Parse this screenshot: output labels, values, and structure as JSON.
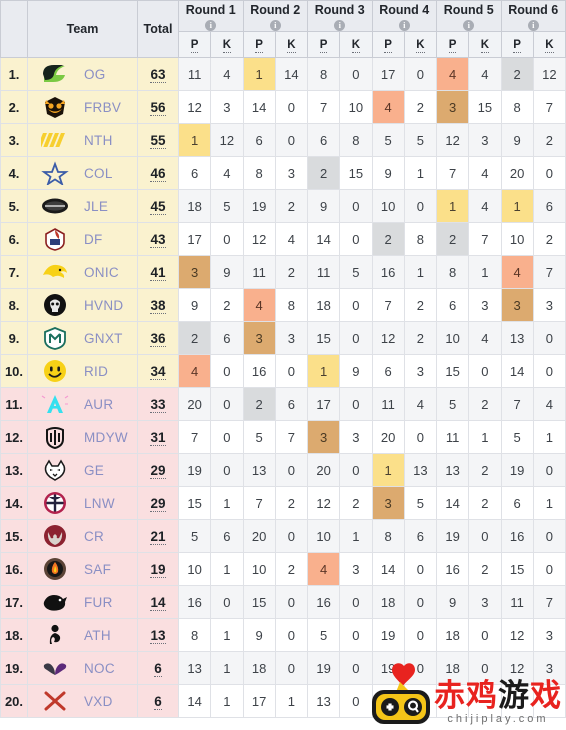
{
  "header": {
    "rank_label": "",
    "team_label": "Team",
    "total_label": "Total",
    "rounds": [
      {
        "label": "Round 1",
        "info": "i",
        "p": "P",
        "k": "K"
      },
      {
        "label": "Round 2",
        "info": "i",
        "p": "P",
        "k": "K"
      },
      {
        "label": "Round 3",
        "info": "i",
        "p": "P",
        "k": "K"
      },
      {
        "label": "Round 4",
        "info": "i",
        "p": "P",
        "k": "K"
      },
      {
        "label": "Round 5",
        "info": "i",
        "p": "P",
        "k": "K"
      },
      {
        "label": "Round 6",
        "info": "i",
        "p": "P",
        "k": "K"
      }
    ]
  },
  "colors": {
    "place_1": "#fbe08a",
    "place_2": "#d9dbdd",
    "place_3": "#dcaa6f",
    "place_4": "#f9b08d",
    "band_gold": "#faf2cf",
    "band_pink": "#fadfe0",
    "team_text": "#8a8fc4",
    "header_bg": "#e9ebf0"
  },
  "watermark": {
    "cn_red_1": "赤鸡",
    "cn_black": "游",
    "cn_red_2": "戏",
    "url": "chijiplay.com",
    "logo": "gamepad-heart-logo"
  },
  "rows": [
    {
      "rank": "1.",
      "team": "OG",
      "logo": "og-logo",
      "total": "63",
      "band": "gold",
      "cells": [
        {
          "v": "11"
        },
        {
          "v": "4"
        },
        {
          "v": "1",
          "hl": 1
        },
        {
          "v": "14"
        },
        {
          "v": "8"
        },
        {
          "v": "0"
        },
        {
          "v": "17"
        },
        {
          "v": "0"
        },
        {
          "v": "4",
          "hl": 4
        },
        {
          "v": "4"
        },
        {
          "v": "2",
          "hl": 2
        },
        {
          "v": "12"
        }
      ]
    },
    {
      "rank": "2.",
      "team": "FRBV",
      "logo": "frbv-logo",
      "total": "56",
      "band": "gold",
      "cells": [
        {
          "v": "12"
        },
        {
          "v": "3"
        },
        {
          "v": "14"
        },
        {
          "v": "0"
        },
        {
          "v": "7"
        },
        {
          "v": "10"
        },
        {
          "v": "4",
          "hl": 4
        },
        {
          "v": "2"
        },
        {
          "v": "3",
          "hl": 3
        },
        {
          "v": "15"
        },
        {
          "v": "8"
        },
        {
          "v": "7"
        }
      ]
    },
    {
      "rank": "3.",
      "team": "NTH",
      "logo": "nth-logo",
      "total": "55",
      "band": "gold",
      "cells": [
        {
          "v": "1",
          "hl": 1
        },
        {
          "v": "12"
        },
        {
          "v": "6"
        },
        {
          "v": "0"
        },
        {
          "v": "6"
        },
        {
          "v": "8"
        },
        {
          "v": "5"
        },
        {
          "v": "5"
        },
        {
          "v": "12"
        },
        {
          "v": "3"
        },
        {
          "v": "9"
        },
        {
          "v": "2"
        }
      ]
    },
    {
      "rank": "4.",
      "team": "COL",
      "logo": "col-logo",
      "total": "46",
      "band": "gold",
      "cells": [
        {
          "v": "6"
        },
        {
          "v": "4"
        },
        {
          "v": "8"
        },
        {
          "v": "3"
        },
        {
          "v": "2",
          "hl": 2
        },
        {
          "v": "15"
        },
        {
          "v": "9"
        },
        {
          "v": "1"
        },
        {
          "v": "7"
        },
        {
          "v": "4"
        },
        {
          "v": "20"
        },
        {
          "v": "0"
        }
      ]
    },
    {
      "rank": "5.",
      "team": "JLE",
      "logo": "jle-logo",
      "total": "45",
      "band": "gold",
      "cells": [
        {
          "v": "18"
        },
        {
          "v": "5"
        },
        {
          "v": "19"
        },
        {
          "v": "2"
        },
        {
          "v": "9"
        },
        {
          "v": "0"
        },
        {
          "v": "10"
        },
        {
          "v": "0"
        },
        {
          "v": "1",
          "hl": 1
        },
        {
          "v": "4"
        },
        {
          "v": "1",
          "hl": 1
        },
        {
          "v": "6"
        }
      ]
    },
    {
      "rank": "6.",
      "team": "DF",
      "logo": "df-logo",
      "total": "43",
      "band": "gold",
      "cells": [
        {
          "v": "17"
        },
        {
          "v": "0"
        },
        {
          "v": "12"
        },
        {
          "v": "4"
        },
        {
          "v": "14"
        },
        {
          "v": "0"
        },
        {
          "v": "2",
          "hl": 2
        },
        {
          "v": "8"
        },
        {
          "v": "2",
          "hl": 2
        },
        {
          "v": "7"
        },
        {
          "v": "10"
        },
        {
          "v": "2"
        }
      ]
    },
    {
      "rank": "7.",
      "team": "ONIC",
      "logo": "onic-logo",
      "total": "41",
      "band": "gold",
      "cells": [
        {
          "v": "3",
          "hl": 3
        },
        {
          "v": "9"
        },
        {
          "v": "11"
        },
        {
          "v": "2"
        },
        {
          "v": "11"
        },
        {
          "v": "5"
        },
        {
          "v": "16"
        },
        {
          "v": "1"
        },
        {
          "v": "8"
        },
        {
          "v": "1"
        },
        {
          "v": "4",
          "hl": 4
        },
        {
          "v": "7"
        }
      ]
    },
    {
      "rank": "8.",
      "team": "HVND",
      "logo": "hvnd-logo",
      "total": "38",
      "band": "gold",
      "cells": [
        {
          "v": "9"
        },
        {
          "v": "2"
        },
        {
          "v": "4",
          "hl": 4
        },
        {
          "v": "8"
        },
        {
          "v": "18"
        },
        {
          "v": "0"
        },
        {
          "v": "7"
        },
        {
          "v": "2"
        },
        {
          "v": "6"
        },
        {
          "v": "3"
        },
        {
          "v": "3",
          "hl": 3
        },
        {
          "v": "3"
        }
      ]
    },
    {
      "rank": "9.",
      "team": "GNXT",
      "logo": "gnxt-logo",
      "total": "36",
      "band": "gold",
      "cells": [
        {
          "v": "2",
          "hl": 2
        },
        {
          "v": "6"
        },
        {
          "v": "3",
          "hl": 3
        },
        {
          "v": "3"
        },
        {
          "v": "15"
        },
        {
          "v": "0"
        },
        {
          "v": "12"
        },
        {
          "v": "2"
        },
        {
          "v": "10"
        },
        {
          "v": "4"
        },
        {
          "v": "13"
        },
        {
          "v": "0"
        }
      ]
    },
    {
      "rank": "10.",
      "team": "RID",
      "logo": "rid-logo",
      "total": "34",
      "band": "gold",
      "cells": [
        {
          "v": "4",
          "hl": 4
        },
        {
          "v": "0"
        },
        {
          "v": "16"
        },
        {
          "v": "0"
        },
        {
          "v": "1",
          "hl": 1
        },
        {
          "v": "9"
        },
        {
          "v": "6"
        },
        {
          "v": "3"
        },
        {
          "v": "15"
        },
        {
          "v": "0"
        },
        {
          "v": "14"
        },
        {
          "v": "0"
        }
      ]
    },
    {
      "rank": "11.",
      "team": "AUR",
      "logo": "aur-logo",
      "total": "33",
      "band": "pink",
      "cells": [
        {
          "v": "20"
        },
        {
          "v": "0"
        },
        {
          "v": "2",
          "hl": 2
        },
        {
          "v": "6"
        },
        {
          "v": "17"
        },
        {
          "v": "0"
        },
        {
          "v": "11"
        },
        {
          "v": "4"
        },
        {
          "v": "5"
        },
        {
          "v": "2"
        },
        {
          "v": "7"
        },
        {
          "v": "4"
        }
      ]
    },
    {
      "rank": "12.",
      "team": "MDYW",
      "logo": "mdyw-logo",
      "total": "31",
      "band": "pink",
      "cells": [
        {
          "v": "7"
        },
        {
          "v": "0"
        },
        {
          "v": "5"
        },
        {
          "v": "7"
        },
        {
          "v": "3",
          "hl": 3
        },
        {
          "v": "3"
        },
        {
          "v": "20"
        },
        {
          "v": "0"
        },
        {
          "v": "11"
        },
        {
          "v": "1"
        },
        {
          "v": "5"
        },
        {
          "v": "1"
        }
      ]
    },
    {
      "rank": "13.",
      "team": "GE",
      "logo": "ge-logo",
      "total": "29",
      "band": "pink",
      "cells": [
        {
          "v": "19"
        },
        {
          "v": "0"
        },
        {
          "v": "13"
        },
        {
          "v": "0"
        },
        {
          "v": "20"
        },
        {
          "v": "0"
        },
        {
          "v": "1",
          "hl": 1
        },
        {
          "v": "13"
        },
        {
          "v": "13"
        },
        {
          "v": "2"
        },
        {
          "v": "19"
        },
        {
          "v": "0"
        }
      ]
    },
    {
      "rank": "14.",
      "team": "LNW",
      "logo": "lnw-logo",
      "total": "29",
      "band": "pink",
      "cells": [
        {
          "v": "15"
        },
        {
          "v": "1"
        },
        {
          "v": "7"
        },
        {
          "v": "2"
        },
        {
          "v": "12"
        },
        {
          "v": "2"
        },
        {
          "v": "3",
          "hl": 3
        },
        {
          "v": "5"
        },
        {
          "v": "14"
        },
        {
          "v": "2"
        },
        {
          "v": "6"
        },
        {
          "v": "1"
        }
      ]
    },
    {
      "rank": "15.",
      "team": "CR",
      "logo": "cr-logo",
      "total": "21",
      "band": "pink",
      "cells": [
        {
          "v": "5"
        },
        {
          "v": "6"
        },
        {
          "v": "20"
        },
        {
          "v": "0"
        },
        {
          "v": "10"
        },
        {
          "v": "1"
        },
        {
          "v": "8"
        },
        {
          "v": "6"
        },
        {
          "v": "19"
        },
        {
          "v": "0"
        },
        {
          "v": "16"
        },
        {
          "v": "0"
        }
      ]
    },
    {
      "rank": "16.",
      "team": "SAF",
      "logo": "saf-logo",
      "total": "19",
      "band": "pink",
      "cells": [
        {
          "v": "10"
        },
        {
          "v": "1"
        },
        {
          "v": "10"
        },
        {
          "v": "2"
        },
        {
          "v": "4",
          "hl": 4
        },
        {
          "v": "3"
        },
        {
          "v": "14"
        },
        {
          "v": "0"
        },
        {
          "v": "16"
        },
        {
          "v": "2"
        },
        {
          "v": "15"
        },
        {
          "v": "0"
        }
      ]
    },
    {
      "rank": "17.",
      "team": "FUR",
      "logo": "fur-logo",
      "total": "14",
      "band": "pink",
      "cells": [
        {
          "v": "16"
        },
        {
          "v": "0"
        },
        {
          "v": "15"
        },
        {
          "v": "0"
        },
        {
          "v": "16"
        },
        {
          "v": "0"
        },
        {
          "v": "18"
        },
        {
          "v": "0"
        },
        {
          "v": "9"
        },
        {
          "v": "3"
        },
        {
          "v": "11"
        },
        {
          "v": "7"
        }
      ]
    },
    {
      "rank": "18.",
      "team": "ATH",
      "logo": "ath-logo",
      "total": "13",
      "band": "pink",
      "cells": [
        {
          "v": "8"
        },
        {
          "v": "1"
        },
        {
          "v": "9"
        },
        {
          "v": "0"
        },
        {
          "v": "5"
        },
        {
          "v": "0"
        },
        {
          "v": "19"
        },
        {
          "v": "0"
        },
        {
          "v": "18"
        },
        {
          "v": "0"
        },
        {
          "v": "12"
        },
        {
          "v": "3"
        }
      ]
    },
    {
      "rank": "19.",
      "team": "NOC",
      "logo": "noc-logo",
      "total": "6",
      "band": "pink",
      "cells": [
        {
          "v": "13"
        },
        {
          "v": "1"
        },
        {
          "v": "18"
        },
        {
          "v": "0"
        },
        {
          "v": "19"
        },
        {
          "v": "0"
        },
        {
          "v": "19"
        },
        {
          "v": "0"
        },
        {
          "v": "18"
        },
        {
          "v": "0"
        },
        {
          "v": "12"
        },
        {
          "v": "3"
        }
      ]
    },
    {
      "rank": "20.",
      "team": "VXD",
      "logo": "vxd-logo",
      "total": "6",
      "band": "pink",
      "cells": [
        {
          "v": "14"
        },
        {
          "v": "1"
        },
        {
          "v": "17"
        },
        {
          "v": "1"
        },
        {
          "v": "13"
        },
        {
          "v": "0"
        },
        {
          "v": ""
        },
        {
          "v": ""
        },
        {
          "v": ""
        },
        {
          "v": ""
        },
        {
          "v": ""
        },
        {
          "v": ""
        }
      ]
    }
  ]
}
